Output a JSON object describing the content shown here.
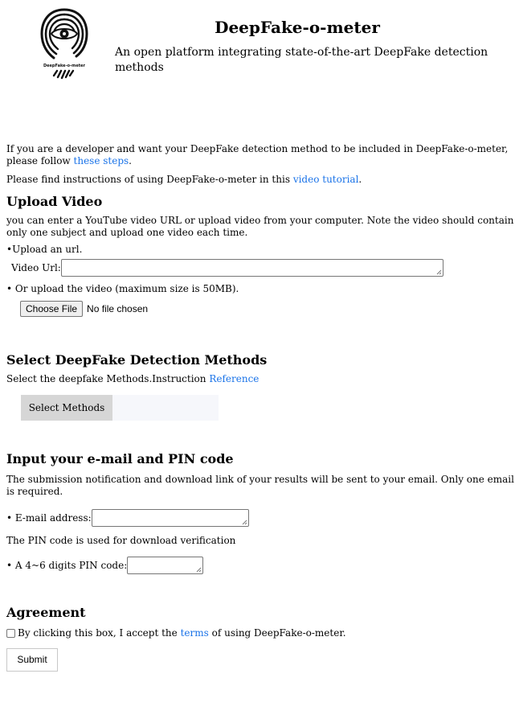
{
  "header": {
    "title": "DeepFake-o-meter",
    "subtitle": "An open platform integrating state-of-the-art DeepFake detection methods",
    "logo_text": "DeepFake-o-meter"
  },
  "intro": {
    "developer_text": "If you are a developer and want your DeepFake detection method to be included in DeepFake-o-meter, please follow",
    "developer_link": "these steps",
    "developer_end": ".",
    "video_text": "Please find instructions of using DeepFake-o-meter in this",
    "video_link": "video tutorial",
    "video_end": "."
  },
  "upload": {
    "heading": "Upload Video",
    "description": "you can enter a YouTube video URL or upload video from your computer. Note the video should contain only one subject and upload one video each time.",
    "url_option": "•Upload an url.",
    "url_label": "Video Url:",
    "url_value": "",
    "file_option": "• Or upload the video (maximum size is 50MB).",
    "choose_file_label": "Choose File",
    "file_status": "No file chosen"
  },
  "methods": {
    "heading": "Select DeepFake Detection Methods",
    "instruction_text": "Select the deepfake Methods.Instruction",
    "instruction_link": "Reference",
    "select_label": "Select Methods"
  },
  "contact": {
    "heading": "Input your e-mail and PIN code",
    "description": "The submission notification and download link of your results will be sent to your email. Only one email is required.",
    "email_label": "• E-mail address:",
    "email_value": "",
    "pin_description": "The PIN code is used for download verification",
    "pin_label": "• A 4~6 digits PIN code:",
    "pin_value": ""
  },
  "agreement": {
    "heading": "Agreement",
    "checkbox_text": "By clicking this box, I accept the",
    "terms_link": "terms",
    "checkbox_end": "of using DeepFake-o-meter.",
    "submit_label": "Submit"
  },
  "colors": {
    "link": "#1a73e8",
    "methods_button": "#d6d6d6"
  }
}
